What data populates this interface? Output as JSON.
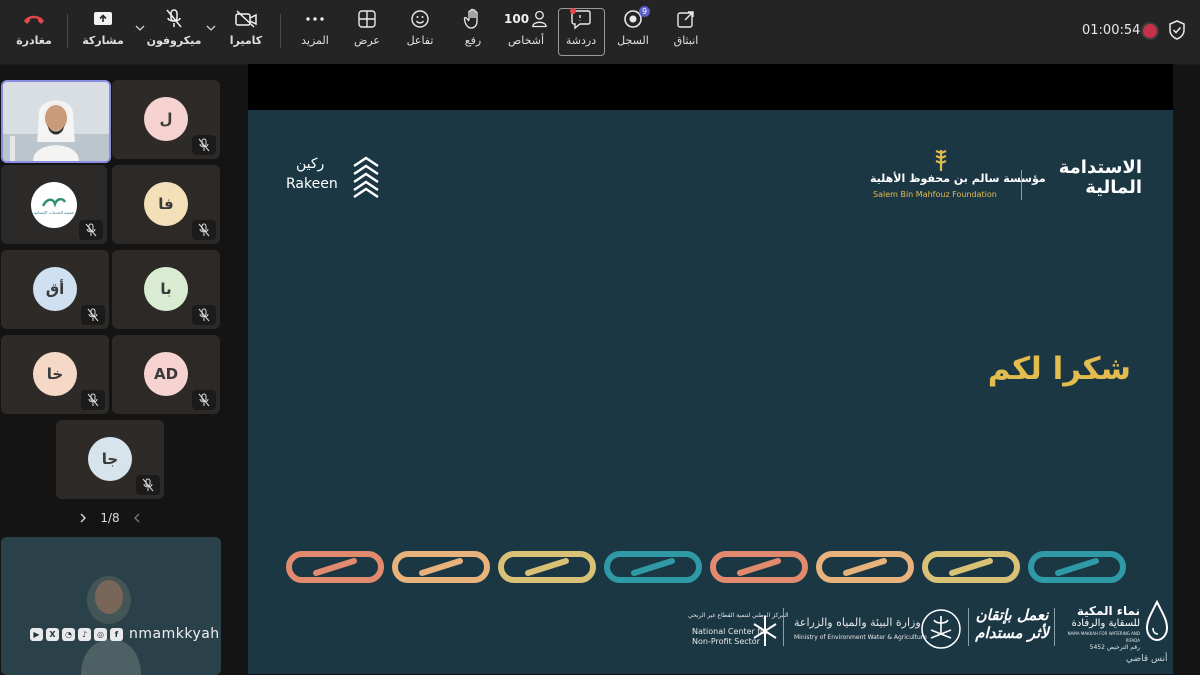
{
  "toolbar": {
    "leave": "مغادرة",
    "share": "مشاركة",
    "mic": "ميكروفون",
    "camera": "كاميرا",
    "more": "المزيد",
    "view": "عرض",
    "react": "تفاعل",
    "raise": "رفع",
    "people_label": "أشخاص",
    "people_count": "100",
    "chat": "دردشة",
    "recap": "السجل",
    "recap_badge": "9",
    "popout": "انبثاق",
    "timer": "01:00:54"
  },
  "gallery": {
    "participants": [
      {
        "initials": "ل",
        "color": "#f6d3d0"
      },
      {
        "initials": "فا",
        "color": "#f3e0b8"
      },
      {
        "initials": "أق",
        "color": "#cfe0f1"
      },
      {
        "initials": "با",
        "color": "#d9ecd2"
      },
      {
        "initials": "خا",
        "color": "#f6d8c6"
      },
      {
        "initials": "AD",
        "color": "#f6d3d0"
      },
      {
        "initials": "جا",
        "color": "#d7e4ec"
      }
    ],
    "logo_text": "جمعية الخدمات الإنسانية",
    "pager": "1/8"
  },
  "slide": {
    "rakeen_ar": "ركين",
    "rakeen_en": "Rakeen",
    "foundation_ar": "مؤسسة سالم بن محفوظ الأهلية",
    "foundation_en": "Salem Bin Mahfouz Foundation",
    "sustain_line1": "الاستدامة",
    "sustain_line2": "المالية",
    "thanks": "شكرا لكم",
    "link_colors": [
      "#e28a6e",
      "#e7b27c",
      "#d9c176",
      "#2f9aa6",
      "#e28a6e",
      "#e7b27c",
      "#d9c176",
      "#2f9aa6"
    ],
    "ncnp_ar": "المركز الوطني لتنمية القطاع غير الربحي",
    "ncnp_en_1": "National Center for",
    "ncnp_en_2": "Non-Profit Sector",
    "mewa_ar": "وزارة البيئة والمياه والزراعة",
    "mewa_en": "Ministry of Environment Water & Agriculture",
    "slogan_1": "نعمل بإتقان",
    "slogan_2": "لأثر مستدام",
    "nama_1": "نماء المكية",
    "nama_2": "للسقاية والرفادة",
    "nama_en": "NAMA MAKKAH FOR WATERING AND RIFADA",
    "nama_num": "رقم الترخيص 5452",
    "presenter": "أنس قاضي"
  },
  "social": {
    "handle": "nmamkkyah",
    "icons": [
      "youtube",
      "x",
      "snapchat",
      "tiktok",
      "instagram",
      "facebook"
    ]
  }
}
